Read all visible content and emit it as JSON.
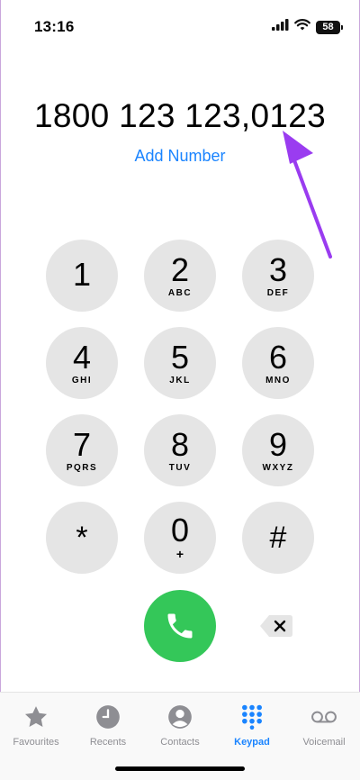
{
  "status": {
    "time": "13:16",
    "battery": "58"
  },
  "dialer": {
    "number": "1800 123 123,0123",
    "add_number": "Add Number",
    "keys": [
      {
        "digit": "1",
        "letters": ""
      },
      {
        "digit": "2",
        "letters": "ABC"
      },
      {
        "digit": "3",
        "letters": "DEF"
      },
      {
        "digit": "4",
        "letters": "GHI"
      },
      {
        "digit": "5",
        "letters": "JKL"
      },
      {
        "digit": "6",
        "letters": "MNO"
      },
      {
        "digit": "7",
        "letters": "PQRS"
      },
      {
        "digit": "8",
        "letters": "TUV"
      },
      {
        "digit": "9",
        "letters": "WXYZ"
      },
      {
        "digit": "*",
        "letters": ""
      },
      {
        "digit": "0",
        "letters": "+"
      },
      {
        "digit": "#",
        "letters": ""
      }
    ]
  },
  "tabs": [
    {
      "label": "Favourites",
      "icon": "star-icon",
      "active": false
    },
    {
      "label": "Recents",
      "icon": "clock-icon",
      "active": false
    },
    {
      "label": "Contacts",
      "icon": "person-icon",
      "active": false
    },
    {
      "label": "Keypad",
      "icon": "keypad-icon",
      "active": true
    },
    {
      "label": "Voicemail",
      "icon": "voicemail-icon",
      "active": false
    }
  ],
  "colors": {
    "accent": "#1a84ff",
    "call": "#34c759",
    "annotation_arrow": "#9a3cf0",
    "key_bg": "#e5e5e5"
  }
}
